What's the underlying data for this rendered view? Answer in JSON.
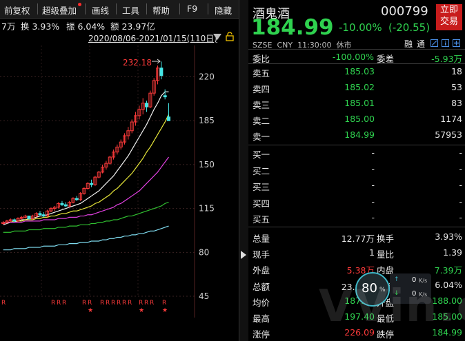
{
  "toolbar": {
    "items": [
      "前复权",
      "超级叠加",
      "画线",
      "工具",
      "帮助",
      "F9",
      "隐藏"
    ]
  },
  "stats": {
    "vol": "7万",
    "turnover": "换 3.93%",
    "amplitude": "振 6.04%",
    "amount": "额 23.97亿"
  },
  "date_range": "2020/08/06-2021/01/15(110日)",
  "chart_data": {
    "type": "candlestick",
    "y_ticks": [
      "220",
      "185",
      "150",
      "115",
      "80",
      "45"
    ],
    "y_tick_values": [
      220,
      185,
      150,
      115,
      80,
      45
    ],
    "ylim": [
      28,
      245
    ],
    "max_label": "232.18",
    "candles": [
      [
        103,
        105,
        102,
        104
      ],
      [
        104,
        106,
        103,
        105
      ],
      [
        105,
        107,
        104,
        106
      ],
      [
        106,
        107,
        104,
        105
      ],
      [
        105,
        108,
        104,
        107
      ],
      [
        107,
        109,
        106,
        108
      ],
      [
        108,
        110,
        107,
        109
      ],
      [
        109,
        109,
        106,
        107
      ],
      [
        107,
        110,
        106,
        109
      ],
      [
        109,
        112,
        108,
        111
      ],
      [
        111,
        113,
        109,
        110
      ],
      [
        110,
        112,
        108,
        109
      ],
      [
        109,
        114,
        108,
        113
      ],
      [
        113,
        116,
        112,
        115
      ],
      [
        115,
        117,
        113,
        116
      ],
      [
        116,
        120,
        115,
        119
      ],
      [
        119,
        121,
        117,
        118
      ],
      [
        118,
        120,
        116,
        117
      ],
      [
        117,
        121,
        116,
        120
      ],
      [
        120,
        124,
        119,
        123
      ],
      [
        123,
        125,
        121,
        122
      ],
      [
        122,
        128,
        121,
        127
      ],
      [
        127,
        132,
        126,
        131
      ],
      [
        131,
        136,
        130,
        135
      ],
      [
        135,
        138,
        132,
        134
      ],
      [
        134,
        141,
        133,
        140
      ],
      [
        140,
        145,
        139,
        144
      ],
      [
        144,
        150,
        143,
        148
      ],
      [
        148,
        153,
        146,
        151
      ],
      [
        151,
        157,
        150,
        156
      ],
      [
        156,
        162,
        154,
        160
      ],
      [
        160,
        166,
        158,
        164
      ],
      [
        164,
        170,
        162,
        168
      ],
      [
        168,
        175,
        166,
        173
      ],
      [
        173,
        180,
        170,
        177
      ],
      [
        177,
        186,
        175,
        184
      ],
      [
        184,
        192,
        181,
        189
      ],
      [
        189,
        197,
        186,
        194
      ],
      [
        194,
        203,
        190,
        199
      ],
      [
        199,
        201,
        192,
        196
      ],
      [
        196,
        209,
        195,
        207
      ],
      [
        207,
        219,
        205,
        217
      ],
      [
        217,
        229,
        214,
        227
      ],
      [
        227,
        232.18,
        218,
        221
      ],
      [
        205,
        210,
        202,
        204
      ],
      [
        188,
        199,
        186,
        185
      ]
    ],
    "ma_series": [
      {
        "color": "#f0f0f0",
        "values": [
          102,
          103,
          104,
          104,
          105,
          106,
          106,
          107,
          107,
          108,
          109,
          109,
          110,
          111,
          112,
          113,
          114,
          115,
          116,
          117,
          118,
          119,
          121,
          123,
          125,
          127,
          129,
          132,
          135,
          138,
          141,
          145,
          149,
          153,
          157,
          162,
          167,
          172,
          177,
          182,
          188,
          194,
          199,
          205,
          208,
          208
        ]
      },
      {
        "color": "#e8e83a",
        "values": [
          104,
          104,
          104,
          105,
          105,
          105,
          106,
          106,
          106,
          107,
          107,
          108,
          108,
          109,
          109,
          110,
          111,
          111,
          112,
          113,
          113,
          114,
          115,
          116,
          117,
          119,
          120,
          122,
          124,
          126,
          129,
          131,
          134,
          137,
          140,
          143,
          147,
          151,
          155,
          160,
          164,
          169,
          174,
          179,
          184,
          190
        ]
      },
      {
        "color": "#e040e0",
        "values": [
          104,
          104,
          104,
          104,
          104,
          104,
          105,
          105,
          105,
          105,
          105,
          106,
          106,
          106,
          106,
          107,
          107,
          107,
          108,
          108,
          108,
          109,
          109,
          110,
          110,
          111,
          112,
          113,
          114,
          115,
          116,
          118,
          119,
          121,
          123,
          125,
          127,
          129,
          132,
          135,
          138,
          141,
          144,
          148,
          152,
          156
        ]
      },
      {
        "color": "#30c030",
        "values": [
          96,
          96,
          96,
          97,
          97,
          97,
          97,
          98,
          98,
          98,
          98,
          99,
          99,
          99,
          99,
          100,
          100,
          100,
          101,
          101,
          101,
          102,
          102,
          102,
          103,
          103,
          104,
          104,
          105,
          105,
          106,
          106,
          107,
          108,
          109,
          109,
          110,
          111,
          112,
          113,
          114,
          115,
          116,
          117,
          119,
          120
        ]
      },
      {
        "color": "#7fdcf0",
        "values": [
          82,
          82,
          82,
          83,
          83,
          83,
          83,
          84,
          84,
          84,
          84,
          85,
          85,
          85,
          85,
          86,
          86,
          86,
          87,
          87,
          87,
          88,
          88,
          88,
          89,
          89,
          89,
          90,
          90,
          91,
          91,
          92,
          92,
          93,
          93,
          94,
          94,
          95,
          95,
          96,
          97,
          97,
          98,
          99,
          100,
          101
        ]
      }
    ]
  },
  "signals": {
    "r_label": "R",
    "star": "★"
  },
  "stock": {
    "name": "酒鬼酒",
    "code": "000799",
    "price": "184.99",
    "change_pct": "-10.00%",
    "change_amt": "(-20.55)",
    "market_line": "SZSE  CNY  11:30:00  休市",
    "tags": [
      "融",
      "通"
    ],
    "trade_button": [
      "立即",
      "交易"
    ]
  },
  "order_ratio": {
    "label1": "委比",
    "value1": "-100.00%",
    "label2": "委差",
    "value2": "-5.93万"
  },
  "asks": [
    {
      "label": "卖五",
      "price": "185.03",
      "vol": "18"
    },
    {
      "label": "卖四",
      "price": "185.02",
      "vol": "53"
    },
    {
      "label": "卖三",
      "price": "185.01",
      "vol": "83"
    },
    {
      "label": "卖二",
      "price": "185.00",
      "vol": "1174"
    },
    {
      "label": "卖一",
      "price": "184.99",
      "vol": "57953"
    }
  ],
  "bids": [
    {
      "label": "买一",
      "price": "-",
      "vol": "-"
    },
    {
      "label": "买二",
      "price": "-",
      "vol": "-"
    },
    {
      "label": "买三",
      "price": "-",
      "vol": "-"
    },
    {
      "label": "买四",
      "price": "-",
      "vol": "-"
    },
    {
      "label": "买五",
      "price": "-",
      "vol": "-"
    }
  ],
  "details": [
    {
      "l1": "总量",
      "v1": "12.77万",
      "l2": "换手",
      "v2": "3.93%"
    },
    {
      "l1": "现手",
      "v1": "1",
      "l2": "量比",
      "v2": "1.39"
    },
    {
      "l1": "外盘",
      "v1": "5.38万",
      "l2": "内盘",
      "v2": "7.39万"
    },
    {
      "l1": "总额",
      "v1": "23.97亿",
      "l2": "振幅",
      "v2": "6.04%"
    },
    {
      "l1": "均价",
      "v1": "187.66",
      "l2": "开盘",
      "v2": "188.00"
    },
    {
      "l1": "最高",
      "v1": "197.40",
      "l2": "最低",
      "v2": "185.00"
    },
    {
      "l1": "涨停",
      "v1": "226.09",
      "l2": "跌停",
      "v2": "184.99"
    }
  ],
  "speed_widget": {
    "percent": "80",
    "pct_sign": "%",
    "up_rate": "0",
    "down_rate": "0",
    "unit": "K/s"
  },
  "watermark": "VVin.cc"
}
